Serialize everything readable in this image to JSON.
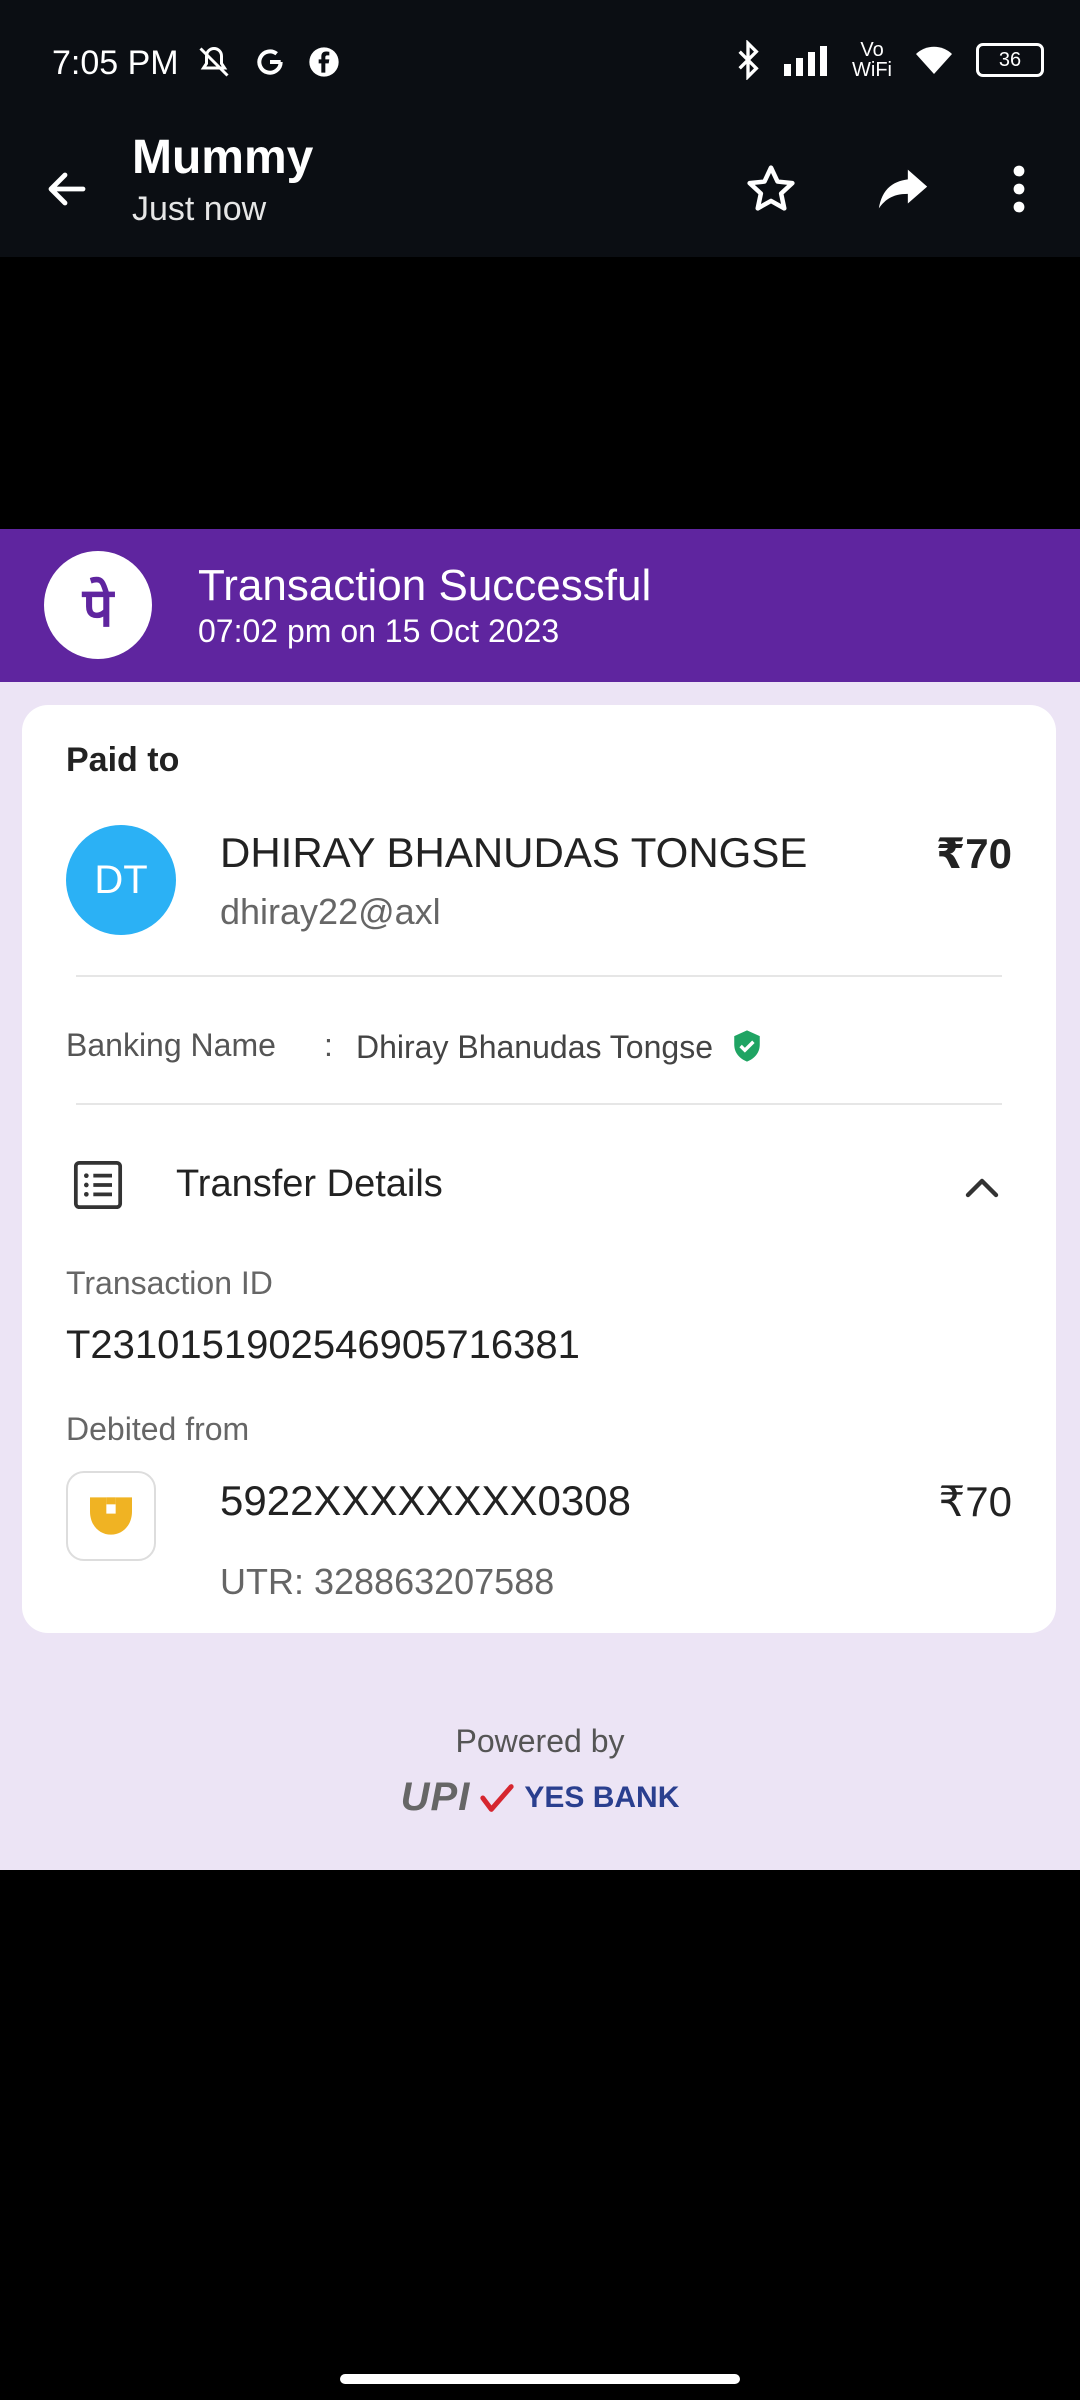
{
  "status_bar": {
    "time": "7:05 PM",
    "battery": "36",
    "icons": [
      "mute-icon",
      "google-icon",
      "facebook-icon",
      "bluetooth-icon",
      "signal-icon",
      "vowifi-icon",
      "wifi-icon",
      "battery-icon"
    ],
    "vowifi_top": "Vo",
    "vowifi_bottom": "WiFi"
  },
  "toolbar": {
    "title": "Mummy",
    "subtitle": "Just now",
    "icons": [
      "back-arrow-icon",
      "star-icon",
      "share-icon",
      "more-vert-icon"
    ]
  },
  "receipt": {
    "banner": {
      "title": "Transaction Successful",
      "datetime": "07:02 pm on 15 Oct 2023",
      "logo_char": "पे"
    },
    "paid_to_label": "Paid to",
    "avatar_initials": "DT",
    "payee_name": "DHIRAY BHANUDAS TONGSE",
    "payee_upi": "dhiray22@axl",
    "amount": "₹70",
    "banking_name_label": "Banking Name",
    "banking_name_colon": ":",
    "banking_name": "Dhiray Bhanudas Tongse",
    "transfer_details_label": "Transfer Details",
    "transaction_id_label": "Transaction ID",
    "transaction_id": "T2310151902546905716381",
    "debited_from_label": "Debited from",
    "account_number": "5922XXXXXXXX0308",
    "debited_amount": "₹70",
    "utr": "UTR: 328863207588",
    "powered_by": "Powered by",
    "upi_logo_text": "UPI",
    "yes_bank_text": "YES BANK"
  },
  "colors": {
    "phonepe_purple": "#5f259f",
    "avatar_blue": "#2bb1f5",
    "verified_green": "#1fa463",
    "receipt_bg": "#ece4f5",
    "pnb_yellow": "#f0b323"
  }
}
